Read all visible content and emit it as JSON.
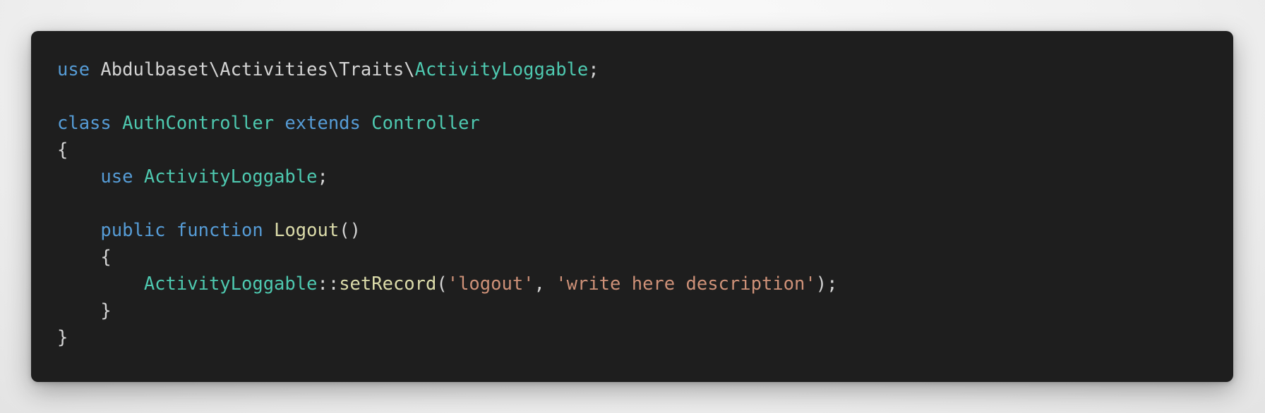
{
  "colors": {
    "background": "#1e1e1e",
    "keyword": "#569cd6",
    "type": "#4ec9b0",
    "function": "#dcdcaa",
    "string": "#ce9178",
    "plain": "#d4d4d4"
  },
  "code": {
    "lines": [
      [
        {
          "text": "use",
          "kind": "kw"
        },
        {
          "text": " Abdulbaset\\Activities\\Traits\\",
          "kind": "plain"
        },
        {
          "text": "ActivityLoggable",
          "kind": "type"
        },
        {
          "text": ";",
          "kind": "plain"
        }
      ],
      [],
      [
        {
          "text": "class",
          "kind": "kw"
        },
        {
          "text": " ",
          "kind": "plain"
        },
        {
          "text": "AuthController",
          "kind": "type"
        },
        {
          "text": " ",
          "kind": "plain"
        },
        {
          "text": "extends",
          "kind": "kw"
        },
        {
          "text": " ",
          "kind": "plain"
        },
        {
          "text": "Controller",
          "kind": "type"
        }
      ],
      [
        {
          "text": "{",
          "kind": "plain"
        }
      ],
      [
        {
          "text": "    ",
          "kind": "plain"
        },
        {
          "text": "use",
          "kind": "kw"
        },
        {
          "text": " ",
          "kind": "plain"
        },
        {
          "text": "ActivityLoggable",
          "kind": "type"
        },
        {
          "text": ";",
          "kind": "plain"
        }
      ],
      [],
      [
        {
          "text": "    ",
          "kind": "plain"
        },
        {
          "text": "public",
          "kind": "kw"
        },
        {
          "text": " ",
          "kind": "plain"
        },
        {
          "text": "function",
          "kind": "kw"
        },
        {
          "text": " ",
          "kind": "plain"
        },
        {
          "text": "Logout",
          "kind": "fn"
        },
        {
          "text": "()",
          "kind": "plain"
        }
      ],
      [
        {
          "text": "    {",
          "kind": "plain"
        }
      ],
      [
        {
          "text": "        ",
          "kind": "plain"
        },
        {
          "text": "ActivityLoggable",
          "kind": "type"
        },
        {
          "text": "::",
          "kind": "plain"
        },
        {
          "text": "setRecord",
          "kind": "fn"
        },
        {
          "text": "(",
          "kind": "plain"
        },
        {
          "text": "'logout'",
          "kind": "str"
        },
        {
          "text": ", ",
          "kind": "plain"
        },
        {
          "text": "'write here description'",
          "kind": "str"
        },
        {
          "text": ");",
          "kind": "plain"
        }
      ],
      [
        {
          "text": "    }",
          "kind": "plain"
        }
      ],
      [
        {
          "text": "}",
          "kind": "plain"
        }
      ]
    ]
  }
}
